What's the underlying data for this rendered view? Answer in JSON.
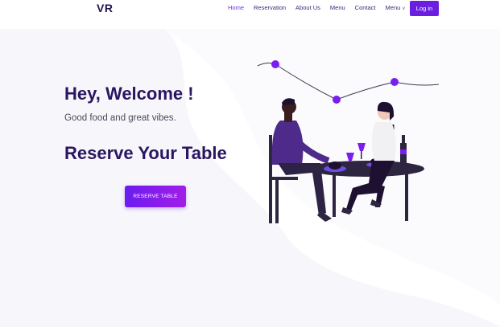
{
  "logo": "VR",
  "nav": {
    "items": [
      {
        "label": "Home",
        "active": true
      },
      {
        "label": "Reservation",
        "active": false
      },
      {
        "label": "About Us",
        "active": false
      },
      {
        "label": "Menu",
        "active": false
      },
      {
        "label": "Contact",
        "active": false
      },
      {
        "label": "Menu",
        "active": false,
        "dropdown": true
      }
    ],
    "login_label": "Log in"
  },
  "hero": {
    "title": "Hey, Welcome !",
    "subtitle": "Good food and great vibes.",
    "headline": "Reserve Your Table",
    "cta_label": "RESERVE TABLE"
  },
  "colors": {
    "accent": "#6a1fe0",
    "heading": "#2a1660",
    "background_shape": "#f6f6fb"
  },
  "icons": [
    "chevron-down-icon"
  ]
}
